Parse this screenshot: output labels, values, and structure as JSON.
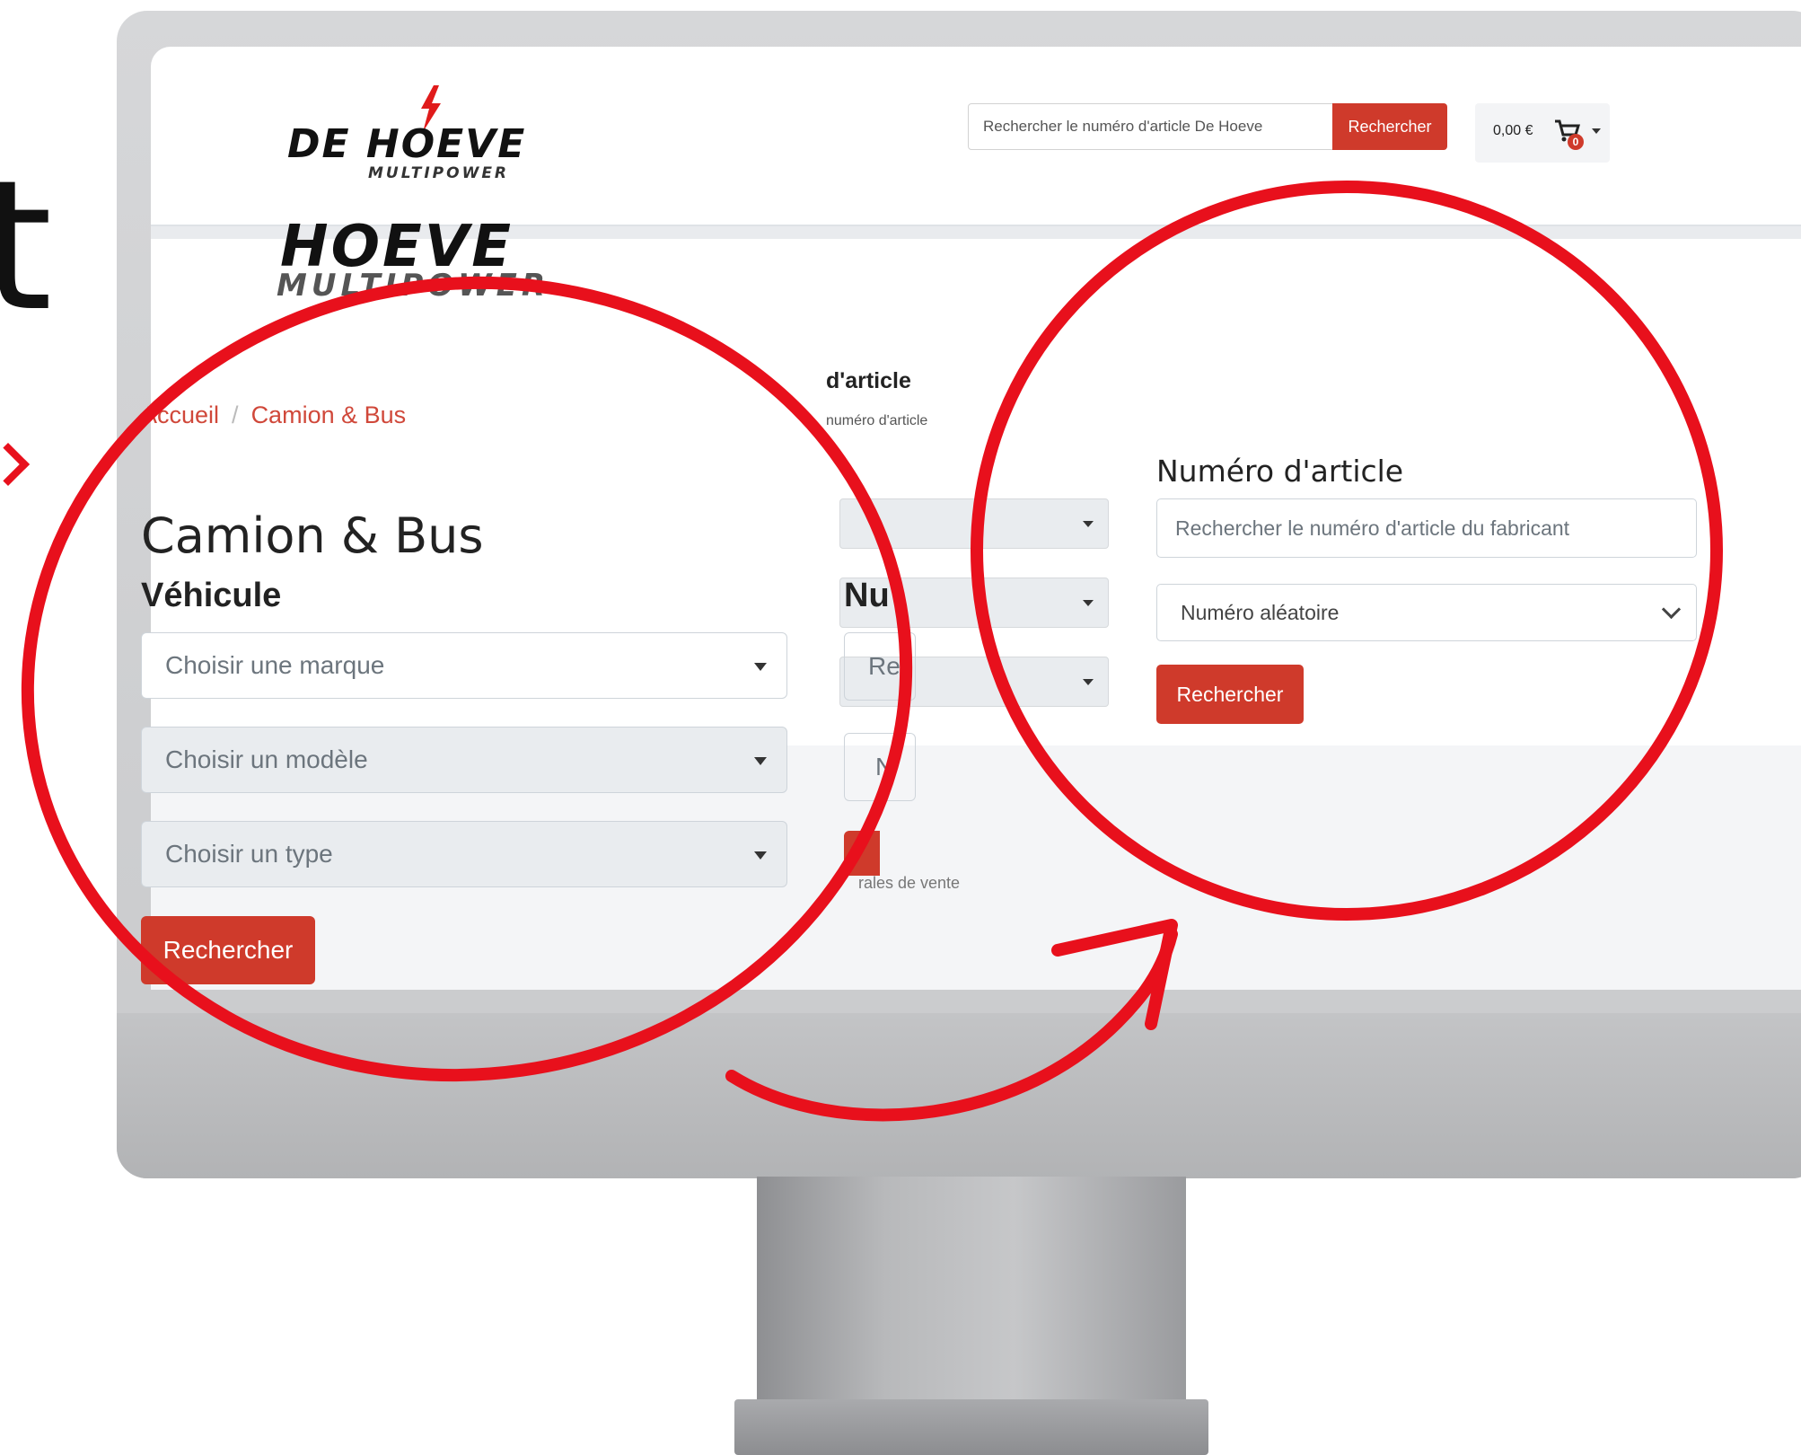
{
  "page_letter": "t",
  "header": {
    "logo_main": "DE HOEVE",
    "logo_sub": "MULTIPOWER",
    "search_placeholder": "Rechercher le numéro d'article De Hoeve",
    "search_button": "Rechercher",
    "cart_total": "0,00 €",
    "cart_count": "0"
  },
  "background": {
    "section_label": "d'article",
    "field_text": "numéro d'article",
    "footer_text": "rales de vente"
  },
  "left_panel": {
    "logo_main": "HOEVE",
    "logo_sub": "MULTIPOWER",
    "breadcrumb": [
      "Accueil",
      "Camion & Bus"
    ],
    "breadcrumb_sep": "/",
    "title": "Camion & Bus",
    "vehicle_heading": "Véhicule",
    "selects": [
      "Choisir une marque",
      "Choisir un modèle",
      "Choisir un type"
    ],
    "search_button": "Rechercher",
    "partial_heading": "Nu",
    "partial_input": "Re",
    "partial_input2": "N"
  },
  "right_panel": {
    "heading": "Numéro d'article",
    "input_placeholder": "Rechercher le numéro d'article du fabricant",
    "select_value": "Numéro aléatoire",
    "search_button": "Rechercher"
  },
  "colors": {
    "accent_red": "#cf3a2b",
    "circle_red": "#e8101c",
    "breadcrumb_link": "#d0483a"
  }
}
